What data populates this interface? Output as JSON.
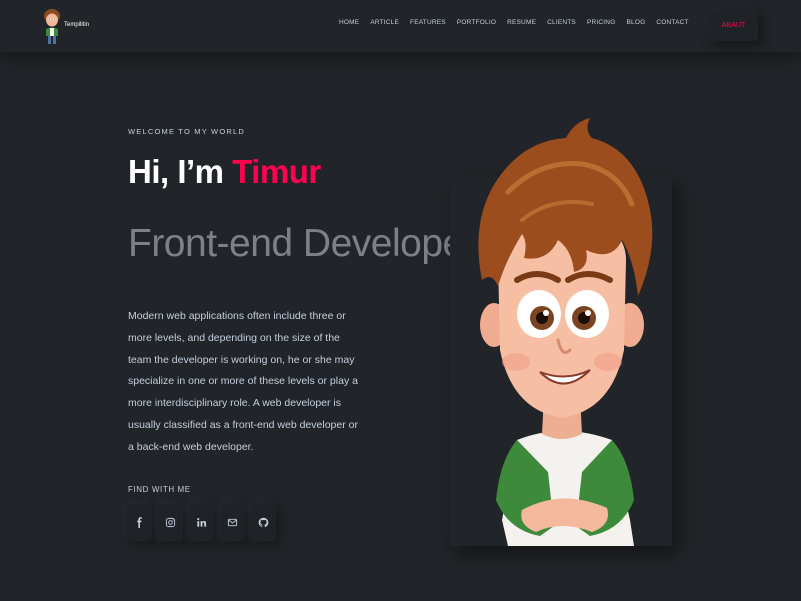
{
  "header": {
    "logo_text": "Tempilitin",
    "nav": [
      "HOME",
      "ARTICLE",
      "FEATURES",
      "PORTFOLIO",
      "RESUME",
      "CLIENTS",
      "PRICING",
      "BLOG",
      "CONTACT"
    ],
    "about_button": "ABAUT"
  },
  "hero": {
    "welcome": "WELCOME TO MY WORLD",
    "greeting": "Hi, I’m ",
    "name": "Timur",
    "role": "Front-end Developer",
    "description": "Modern web applications often include three or more levels, and depending on the size of the team the developer is working on, he or she may specialize in one or more of these levels or play a more interdisciplinary role. A web developer is usually classified as a front-end web developer or a back-end web developer.",
    "find_with_me": "FIND WITH ME",
    "socials": [
      "facebook-icon",
      "instagram-icon",
      "linkedin-icon",
      "mail-icon",
      "github-icon"
    ]
  },
  "colors": {
    "background": "#212428",
    "accent": "#ff014f",
    "text": "#c4cfde",
    "heading": "#ffffff",
    "role": "#7e8087"
  }
}
